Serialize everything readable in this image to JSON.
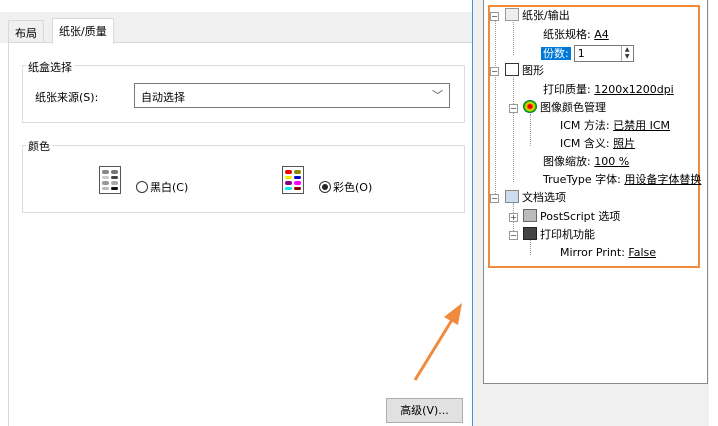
{
  "tabs": [
    {
      "label": "布局"
    },
    {
      "label": "纸张/质量"
    }
  ],
  "tray_group": {
    "title": "纸盒选择",
    "source_label": "纸张来源(S):",
    "source_value": "自动选择"
  },
  "color_group": {
    "title": "颜色",
    "bw_label": "黑白(C)",
    "color_label": "彩色(O)",
    "selected": "color"
  },
  "advanced_button": "高级(V)...",
  "tree": {
    "paper_output": "纸张/输出",
    "paper_size_label": "纸张规格:",
    "paper_size_value": "A4",
    "copies_label": "份数:",
    "copies_value": "1",
    "graphics": "图形",
    "print_quality_label": "打印质量:",
    "print_quality_value": "1200x1200dpi",
    "icm": "图像颜色管理",
    "icm_method_label": "ICM 方法:",
    "icm_method_value": "已禁用 ICM",
    "icm_intent_label": "ICM 含义:",
    "icm_intent_value": "照片",
    "scaling_label": "图像缩放:",
    "scaling_value": "100 %",
    "truetype_label": "TrueType 字体:",
    "truetype_value": "用设备字体替换",
    "doc_options": "文档选项",
    "postscript": "PostScript 选项",
    "printer_features": "打印机功能",
    "mirror_label": "Mirror Print:",
    "mirror_value": "False"
  },
  "colors": {
    "highlight": "#f08a3c",
    "selection": "#0078d7"
  }
}
